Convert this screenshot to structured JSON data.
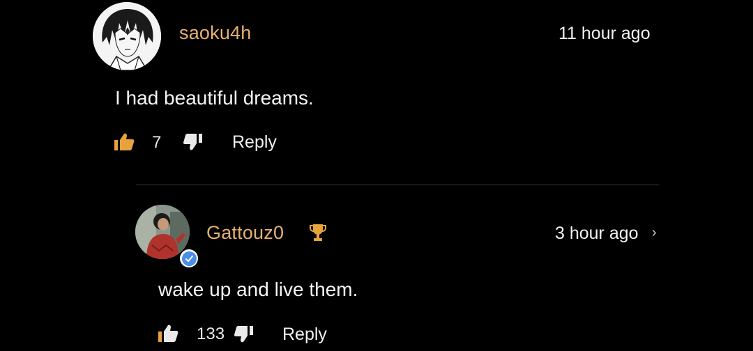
{
  "comment": {
    "username": "saoku4h",
    "timestamp": "11 hour ago",
    "text": "I had beautiful dreams.",
    "likes": "7",
    "reply_label": "Reply"
  },
  "reply": {
    "username": "Gattouz0",
    "timestamp": "3 hour ago",
    "text": "wake up and live them.",
    "likes": "133",
    "reply_label": "Reply"
  },
  "icons": {
    "like": "thumbs-up-icon",
    "dislike": "thumbs-down-icon",
    "trophy": "trophy-icon",
    "verified": "verified-badge-icon",
    "chevron": "chevron-right-icon"
  },
  "colors": {
    "background": "#000000",
    "username": "#e6b071",
    "like_active": "#e6a23c",
    "text": "#f4f4f4",
    "verified": "#4a8ee8"
  }
}
